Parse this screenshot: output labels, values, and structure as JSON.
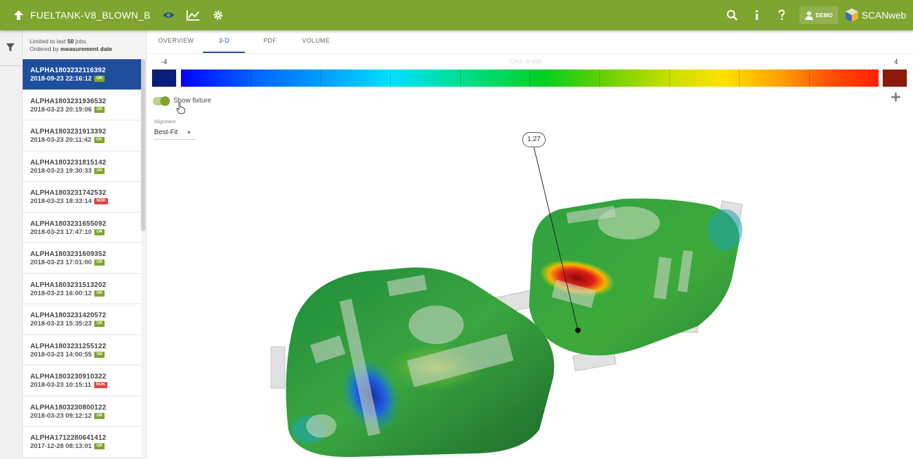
{
  "header": {
    "title": "FUELTANK-V8_BLOWN_B",
    "user_label": "DEMO",
    "brand": "SCANweb",
    "accent": "#7ea52f"
  },
  "joblist": {
    "limit_prefix": "Limited to last",
    "limit_count": "50",
    "limit_suffix": "jobs",
    "order_prefix": "Ordered by",
    "order_field": "measurement date",
    "jobs": [
      {
        "id": "ALPHA1803232116392",
        "date": "2018-09-23 22:16:12",
        "status": "OK",
        "selected": true
      },
      {
        "id": "ALPHA1803231936532",
        "date": "2018-03-23 20:19:06",
        "status": "OK"
      },
      {
        "id": "ALPHA1803231913392",
        "date": "2018-03-23 20:11:42",
        "status": "OK"
      },
      {
        "id": "ALPHA1803231815142",
        "date": "2018-03-23 19:30:33",
        "status": "OK"
      },
      {
        "id": "ALPHA1803231742532",
        "date": "2018-03-23 18:33:14",
        "status": "NOK"
      },
      {
        "id": "ALPHA1803231655092",
        "date": "2018-03-23 17:47:10",
        "status": "OK"
      },
      {
        "id": "ALPHA1803231609352",
        "date": "2018-03-23 17:01:00",
        "status": "OK"
      },
      {
        "id": "ALPHA1803231513202",
        "date": "2018-03-23 16:00:12",
        "status": "OK"
      },
      {
        "id": "ALPHA1803231420572",
        "date": "2018-03-23 15:35:23",
        "status": "OK"
      },
      {
        "id": "ALPHA1803231255122",
        "date": "2018-03-23 14:00:55",
        "status": "OK"
      },
      {
        "id": "ALPHA1803230910322",
        "date": "2018-03-23 10:15:11",
        "status": "NOK"
      },
      {
        "id": "ALPHA1803230800122",
        "date": "2018-03-23 09:12:12",
        "status": "OK"
      },
      {
        "id": "ALPHA1712280641412",
        "date": "2017-12-28 08:13:01",
        "status": "OK"
      }
    ]
  },
  "tabs": [
    "OVERVIEW",
    "3-D",
    "PDF",
    "VOLUME"
  ],
  "active_tab": "3-D",
  "scale": {
    "min": "-4",
    "max": "4",
    "hint": "Click to edit"
  },
  "fixture": {
    "label": "Show fixture",
    "on": true
  },
  "alignment": {
    "label": "Alignment",
    "value": "Best-Fit"
  },
  "callout_value": "1.27"
}
